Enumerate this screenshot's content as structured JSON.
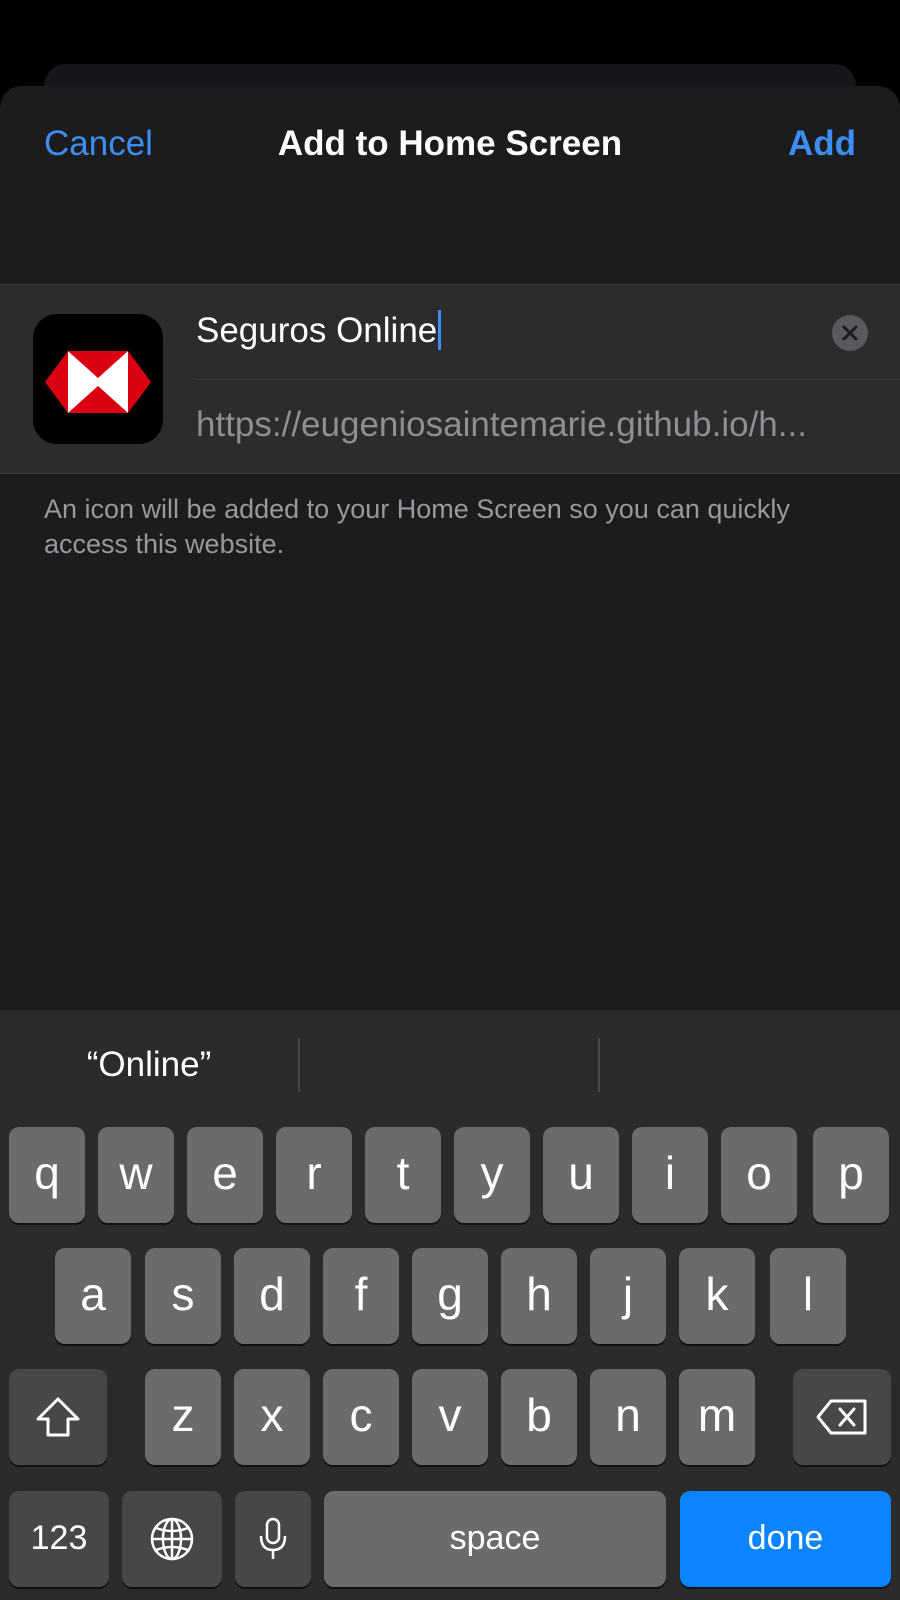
{
  "header": {
    "cancel_label": "Cancel",
    "title": "Add to Home Screen",
    "add_label": "Add"
  },
  "bookmark": {
    "icon": "hsbc-hexagon-logo",
    "name_value": "Seguros Online",
    "url": "https://eugeniosaintemarie.github.io/h..."
  },
  "footnote": "An icon will be added to your Home Screen so you can quickly access this website.",
  "keyboard": {
    "suggestions": [
      "“Online”",
      "",
      ""
    ],
    "row1": [
      "q",
      "w",
      "e",
      "r",
      "t",
      "y",
      "u",
      "i",
      "o",
      "p"
    ],
    "row2": [
      "a",
      "s",
      "d",
      "f",
      "g",
      "h",
      "j",
      "k",
      "l"
    ],
    "row3": [
      "z",
      "x",
      "c",
      "v",
      "b",
      "n",
      "m"
    ],
    "numbers_label": "123",
    "space_label": "space",
    "done_label": "done",
    "icons": {
      "shift": "shift-arrow-icon",
      "delete": "backspace-icon",
      "globe": "globe-icon",
      "mic": "microphone-icon",
      "clear": "clear-circle-icon"
    }
  },
  "colors": {
    "accent": "#3d8ff5",
    "done_key": "#0a84ff",
    "sheet_bg": "#1c1c1e",
    "card_bg": "#2c2c2e",
    "keyboard_bg": "#2b2b2d",
    "logo_red": "#db0011"
  }
}
